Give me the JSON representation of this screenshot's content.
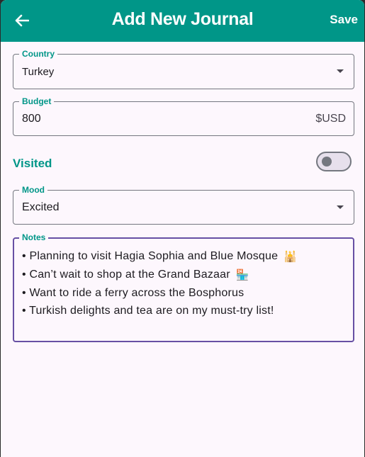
{
  "app_bar": {
    "title": "Add New Journal",
    "save_label": "Save",
    "back_icon": "arrow-left-icon",
    "background": "#009688"
  },
  "form": {
    "country": {
      "label": "Country",
      "value": "Turkey"
    },
    "budget": {
      "label": "Budget",
      "value": "800",
      "suffix": "$USD"
    },
    "visited": {
      "label": "Visited",
      "on": false
    },
    "mood": {
      "label": "Mood",
      "value": "Excited"
    },
    "notes": {
      "label": "Notes",
      "lines": [
        {
          "text": "• Planning to visit Hagia Sophia and Blue Mosque",
          "emoji": "🕌"
        },
        {
          "text": "• Can’t wait to shop at the Grand Bazaar",
          "emoji": "🏪"
        },
        {
          "text": "• Want to ride a ferry across the Bosphorus",
          "emoji": ""
        },
        {
          "text": "• Turkish delights and tea are on my must-try list!",
          "emoji": ""
        }
      ]
    }
  },
  "colors": {
    "accent": "#009688",
    "focused_border": "#6750a4",
    "surface": "#fdf7fd"
  }
}
